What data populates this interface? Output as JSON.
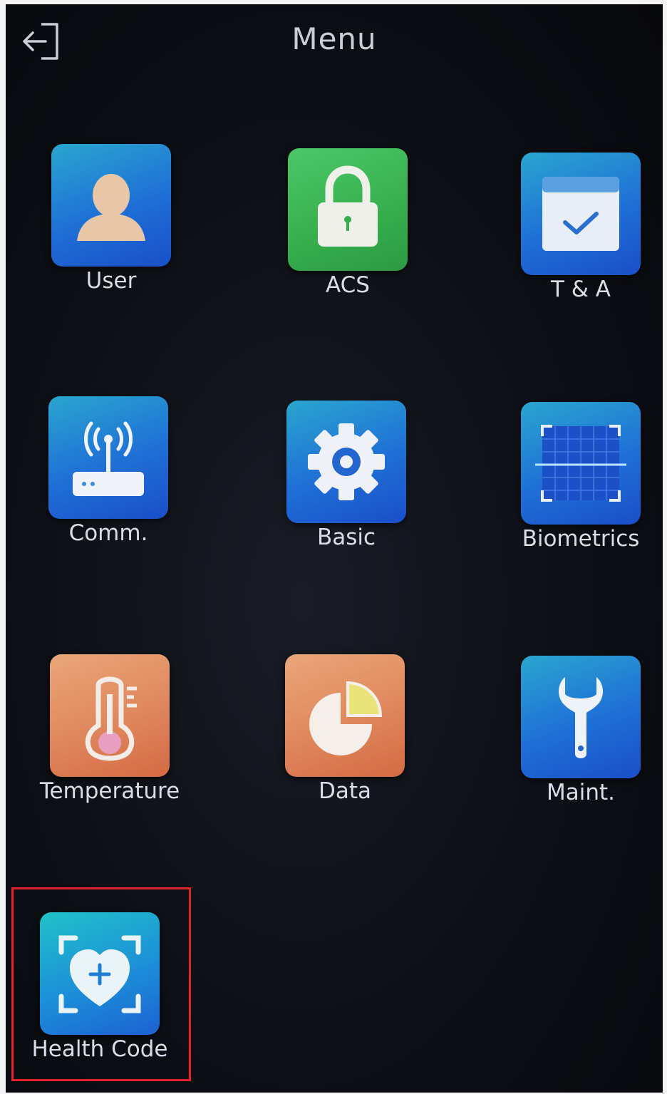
{
  "header": {
    "title": "Menu",
    "back_icon": "exit-arrow-icon"
  },
  "menu": {
    "items": [
      {
        "label": "User",
        "icon": "user-icon",
        "color": "#2a8fd6"
      },
      {
        "label": "ACS",
        "icon": "lock-icon",
        "color": "#3bb356"
      },
      {
        "label": "T & A",
        "icon": "calendar-check-icon",
        "color": "#2a8fd6"
      },
      {
        "label": "Comm.",
        "icon": "router-icon",
        "color": "#2a8fd6"
      },
      {
        "label": "Basic",
        "icon": "gear-icon",
        "color": "#2a8fd6"
      },
      {
        "label": "Biometrics",
        "icon": "scan-grid-icon",
        "color": "#2a8fd6"
      },
      {
        "label": "Temperature",
        "icon": "thermometer-icon",
        "color": "#e0875c"
      },
      {
        "label": "Data",
        "icon": "pie-chart-icon",
        "color": "#e0875c"
      },
      {
        "label": "Maint.",
        "icon": "wrench-icon",
        "color": "#2a8fd6"
      },
      {
        "label": "Health Code",
        "icon": "heart-scan-icon",
        "color": "#1ca6d0"
      }
    ]
  },
  "highlight_color": "#e3232b"
}
